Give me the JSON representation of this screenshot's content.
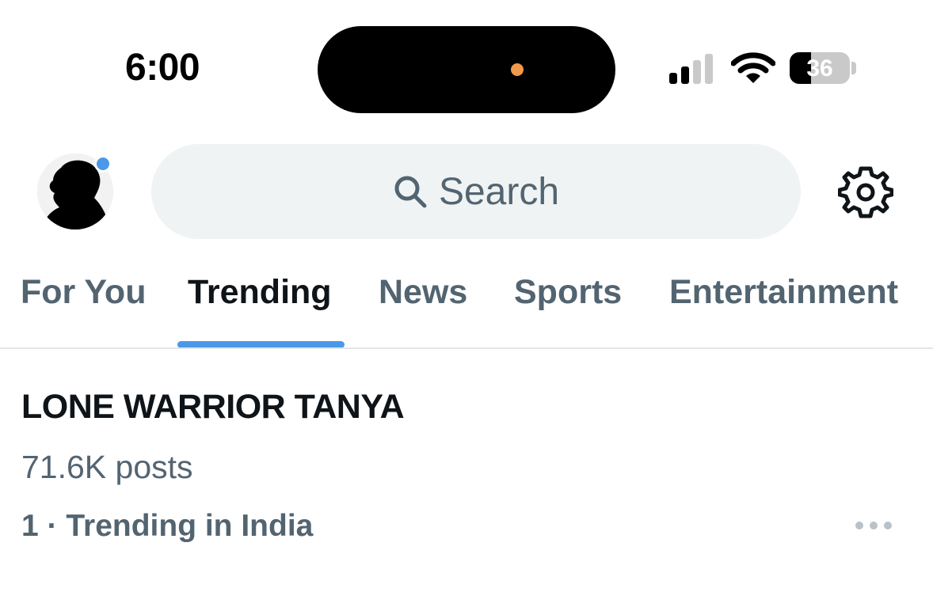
{
  "status_bar": {
    "time": "6:00",
    "signal_bars_active": 2,
    "signal_bars_total": 4,
    "battery_level": "36",
    "battery_fraction": 0.36,
    "icons": [
      "cellular-signal-icon",
      "wifi-icon",
      "battery-icon"
    ]
  },
  "header": {
    "search_placeholder": "Search",
    "avatar_has_notification": true,
    "icons": [
      "search-icon",
      "gear-icon"
    ]
  },
  "tabs": [
    {
      "label": "For You",
      "active": false
    },
    {
      "label": "Trending",
      "active": true
    },
    {
      "label": "News",
      "active": false
    },
    {
      "label": "Sports",
      "active": false
    },
    {
      "label": "Entertainment",
      "active": false
    }
  ],
  "trend": {
    "title": "LONE WARRIOR TANYA",
    "posts": "71.6K posts",
    "meta": "1 · Trending in India"
  },
  "colors": {
    "accent": "#4a99e9",
    "secondary_text": "#536471",
    "primary_text": "#0f1419",
    "search_bg": "#eff3f4",
    "island_dot": "#f19a4a"
  }
}
